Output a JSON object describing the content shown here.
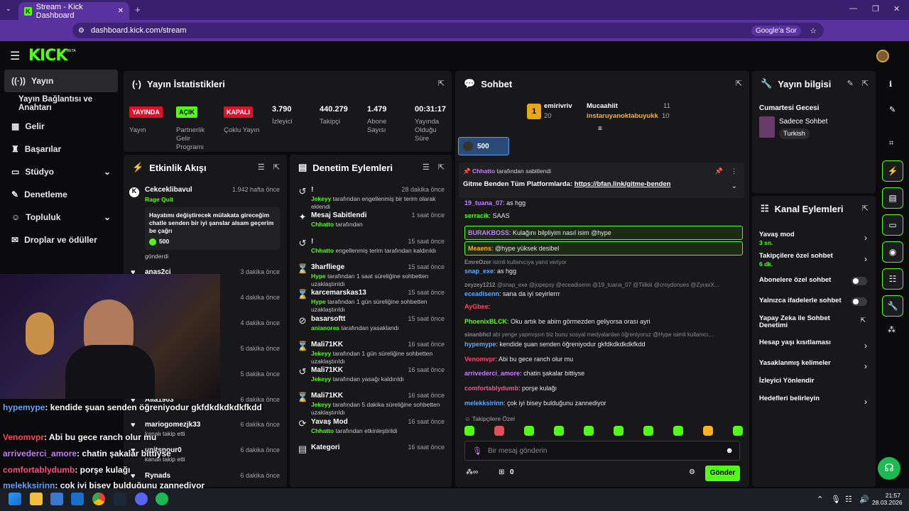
{
  "browser": {
    "tab_title": "Stream - Kick Dashboard",
    "url": "dashboard.kick.com/stream",
    "google_btn": "Google'a Sor"
  },
  "sidebar": {
    "items": [
      {
        "label": "Yayın"
      },
      {
        "label": "Yayın Bağlantısı ve Anahtarı"
      },
      {
        "label": "Gelir"
      },
      {
        "label": "Başarılar"
      },
      {
        "label": "Stüdyo"
      },
      {
        "label": "Denetleme"
      },
      {
        "label": "Topluluk"
      },
      {
        "label": "Droplar ve ödüller"
      }
    ]
  },
  "stats": {
    "title": "Yayın İstatistikleri",
    "badges": [
      {
        "text": "YAYINDA",
        "label": "Yayın"
      },
      {
        "text": "AÇIK",
        "label": "Partnerlik Gelir Programı"
      },
      {
        "text": "KAPALI",
        "label": "Çoklu Yayın"
      }
    ],
    "values": [
      {
        "value": "3.790",
        "label": "İzleyici"
      },
      {
        "value": "440.279",
        "label": "Takipçi"
      },
      {
        "value": "1.479",
        "label": "Abone Sayısı"
      },
      {
        "value": "00:31:17",
        "label": "Yayında Olduğu Süre"
      }
    ],
    "colors": {
      "live": "#e0102a",
      "on": "#53fc18",
      "off": "#e0102a"
    }
  },
  "activity": {
    "title": "Etkinlik Akışı",
    "items": [
      {
        "name": "Cekceklibavul",
        "time": "1.942 hafta önce",
        "sub": "Rage Quit",
        "message": "Hayatımı değiştirecek mülakata gireceğim chatle senden bir iyi şanslar alsam geçerim be çağrı",
        "amount": "500",
        "action": "gönderdi"
      },
      {
        "name": "anas2ci",
        "time": "3 dakika önce"
      },
      {
        "name": "",
        "time": "4 dakika önce"
      },
      {
        "name": "",
        "time": "4 dakika önce"
      },
      {
        "name": "",
        "time": "5 dakika önce"
      },
      {
        "name": "",
        "time": "5 dakika önce"
      },
      {
        "name": "Alla1903",
        "time": "6 dakika önce"
      },
      {
        "name": "mariogomezjk33",
        "time": "6 dakika önce",
        "sub": "kanalı takip etti"
      },
      {
        "name": "unitsnour0",
        "time": "6 dakika önce",
        "sub": "kanalı takip etti"
      },
      {
        "name": "Rynads",
        "time": "6 dakika önce"
      }
    ]
  },
  "moderation": {
    "title": "Denetim Eylemleri",
    "items": [
      {
        "icon": "↺",
        "name": "!",
        "time": "28 dakika önce",
        "who": "Jekeyy",
        "text": "tarafından engellenmiş bir terim olarak eklendi"
      },
      {
        "icon": "✦",
        "name": "Mesaj Sabitlendi",
        "time": "1 saat önce",
        "who": "Chhatto",
        "text": "tarafından"
      },
      {
        "icon": "↺",
        "name": "!",
        "time": "15 saat önce",
        "who": "Chhatto",
        "text": "engellenmiş terim  tarafından kaldırıldı"
      },
      {
        "icon": "⌛",
        "name": "3harfliege",
        "time": "15 saat önce",
        "who": "Hype",
        "text": "tarafından 1 saat süreliğine sohbetten uzaklaştırıldı"
      },
      {
        "icon": "⌛",
        "name": "karcemarskas13",
        "time": "15 saat önce",
        "who": "Hype",
        "text": "tarafından 1 gün süreliğine sohbetten uzaklaştırıldı"
      },
      {
        "icon": "⊘",
        "name": "basarsoftt",
        "time": "15 saat önce",
        "who": "anianores",
        "text": "tarafından yasaklandı"
      },
      {
        "icon": "⌛",
        "name": "Mali71KK",
        "time": "16 saat önce",
        "who": "Jekeyy",
        "text": "tarafından 1 gün süreliğine sohbetten uzaklaştırıldı"
      },
      {
        "icon": "↺",
        "name": "Mali71KK",
        "time": "16 saat önce",
        "who": "Jekeyy",
        "text": "tarafından yasağı kaldırıldı"
      },
      {
        "icon": "⌛",
        "name": "Mali71KK",
        "time": "16 saat önce",
        "who": "Jekeyy",
        "text": "tarafından 5 dakika süreliğine sohbetten uzaklaştırıldı"
      },
      {
        "icon": "⟳",
        "name": "Yavaş Mod",
        "time": "16 saat önce",
        "who": "Chhatto",
        "text": "tarafından etkinleştirildi"
      },
      {
        "icon": "▤",
        "name": "Kategori",
        "time": "16 saat önce",
        "who": "",
        "text": ""
      }
    ]
  },
  "chat": {
    "title": "Sohbet",
    "leaders": [
      {
        "name": "emirivriv",
        "value": "20"
      },
      {
        "name": "Mucaahiit",
        "value": "11"
      },
      {
        "name": "instaruyanoktabuyukk",
        "value": "10"
      }
    ],
    "leader_rank": "1",
    "gift_amount": "500",
    "pinned_by": "Chhatto",
    "pinned_by_text": "tarafından sabitlendi",
    "pinned_text": "Gitme Benden Tüm Platformlarda:",
    "pinned_link": "https://bfan.link/gitme-benden",
    "messages": [
      {
        "user": "19_tuana_07",
        "color": "#c77dff",
        "text": "as hgg"
      },
      {
        "user": "serracik",
        "color": "#53fc18",
        "text": "SAAS"
      },
      {
        "user": "BURAKBOSS",
        "color": "#c77dff",
        "text": "Kulağını bilpliyim nasıl isim @hype",
        "highlight": "yes"
      },
      {
        "user": "Meaens",
        "color": "#ffb020",
        "text": "@hype yüksek desibel",
        "highlight": "yes"
      },
      {
        "user": "EmreOzer",
        "color": "#8a8a90",
        "text": "isimli kullanıcıya yanıt veriyor",
        "reply": "yes"
      },
      {
        "user": "snap_exe",
        "color": "#5fa8ff",
        "text": "as hgg"
      },
      {
        "user": "zeyzey1212",
        "color": "#8a8a90",
        "text": "@snap_exe @jopepsy @eceadisenn @19_tuana_07 @Tiilkiii @croydonues @ZyraxX...",
        "reply": "yes"
      },
      {
        "user": "eceadisenn",
        "color": "#5fa8ff",
        "text": "sana da iyi seyirlerrr"
      },
      {
        "user": "AyGbee",
        "color": "#ff4466",
        "text": ""
      },
      {
        "user": "PhoenixBLCK",
        "color": "#53fc18",
        "text": "Oku artık be abim görmezden geliyorsa orası ayri"
      },
      {
        "user": "sinanbhcl",
        "color": "#8a8a90",
        "text": "abi yenge yapmışsın biz bunu sosyal medyalardan öğreniyoruz @Hype isimli kullanıcı...",
        "reply": "yes"
      },
      {
        "user": "hypemype",
        "color": "#5fa8ff",
        "text": "kendide şuan senden öğreniyodur gkfdkdkdkdkfkdd"
      },
      {
        "user": "Venomvpr",
        "color": "#ff4466",
        "text": "Abi bu gece ranch olur mu"
      },
      {
        "user": "arrivederci_amore",
        "color": "#c77dff",
        "text": "chatin şakalar bittiyse"
      },
      {
        "user": "comfortablydumb",
        "color": "#ff4d88",
        "text": "porşe kulağı"
      },
      {
        "user": "melekksirinn",
        "color": "#5fa8ff",
        "text": "çok iyi bisey bulduğunu zannediyor"
      }
    ],
    "followers_only": "Takipçilere Özel",
    "input_placeholder": "Bir mesaj gönderin",
    "points": "0",
    "send_label": "Gönder"
  },
  "stream_info": {
    "title": "Yayın bilgisi",
    "stream_title": "Cumartesi Gecesi",
    "category": "Sadece Sohbet",
    "language": "Turkish"
  },
  "channel_actions": {
    "title": "Kanal Eylemleri",
    "items": [
      {
        "label": "Yavaş mod",
        "sub": "3 sn.",
        "control": "chevron"
      },
      {
        "label": "Takipçilere özel sohbet",
        "sub": "6 dk.",
        "control": "chevron"
      },
      {
        "label": "Abonelere özel sohbet",
        "sub": "",
        "control": "toggle"
      },
      {
        "label": "Yalnızca ifadelerle sohbet",
        "sub": "",
        "control": "toggle"
      },
      {
        "label": "Yapay Zeka ile Sohbet Denetimi",
        "sub": "",
        "control": "link"
      },
      {
        "label": "Hesap yaşı kısıtlaması",
        "sub": "",
        "control": "chevron"
      },
      {
        "label": "Yasaklanmış kelimeler",
        "sub": "",
        "control": "chevron"
      },
      {
        "label": "İzleyici Yönlendir",
        "sub": "",
        "control": "none"
      },
      {
        "label": "Hedefleri belirleyin",
        "sub": "",
        "control": "chevron"
      }
    ]
  },
  "overlay_chat": [
    {
      "user": "hypemype",
      "color": "#5fa8ff",
      "text": ": kendide şuan senden öğreniyodur gkfdkdkdkdkfkdd"
    },
    {
      "user": "Venomvpr",
      "color": "#ff4466",
      "text": ": Abi bu gece ranch olur mu"
    },
    {
      "user": "arrivederci_amore",
      "color": "#c77dff",
      "text": ": chatin şakalar bittiyse"
    },
    {
      "user": "comfortablydumb",
      "color": "#ff4d88",
      "text": ": porşe kulağı"
    },
    {
      "user": "melekksirinn",
      "color": "#5fa8ff",
      "text": ": çok iyi bisey bulduğunu zannediyor"
    }
  ],
  "taskbar": {
    "time": "21:57",
    "date": "28.03.2026"
  }
}
